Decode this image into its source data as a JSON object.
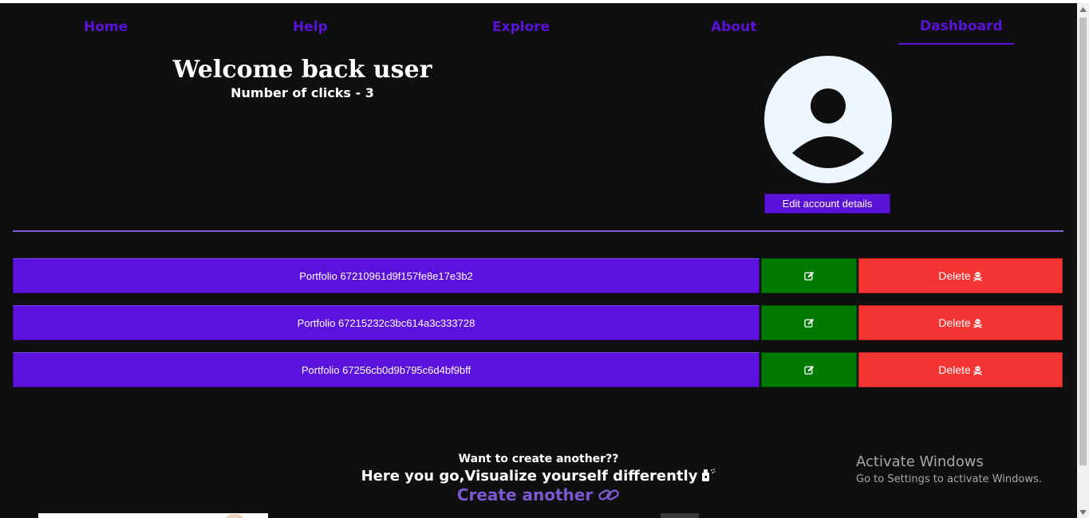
{
  "nav": {
    "items": [
      {
        "label": "Home"
      },
      {
        "label": "Help"
      },
      {
        "label": "Explore"
      },
      {
        "label": "About"
      },
      {
        "label": "Dashboard",
        "active": true
      }
    ]
  },
  "welcome": {
    "title": "Welcome back user",
    "clicks": "Number of clicks - 3"
  },
  "account": {
    "edit_label": "Edit account details",
    "avatar_icon": "user-avatar-icon"
  },
  "portfolios": [
    {
      "label": "Portfolio 67210961d9f157fe8e17e3b2",
      "delete_label": "Delete"
    },
    {
      "label": "Portfolio 67215232c3bc614a3c333728",
      "delete_label": "Delete"
    },
    {
      "label": "Portfolio 67256cb0d9b795c6d4bf9bff",
      "delete_label": "Delete"
    }
  ],
  "cta": {
    "line1": "Want to create another??",
    "line2": "Here you go,Visualize yourself differently",
    "link": "Create another"
  },
  "watermark": {
    "title": "Activate Windows",
    "subtitle": "Go to Settings to activate Windows."
  },
  "colors": {
    "accent": "#5b12dd",
    "edit": "#007a00",
    "delete": "#f43333",
    "background": "#0f0f0f"
  }
}
